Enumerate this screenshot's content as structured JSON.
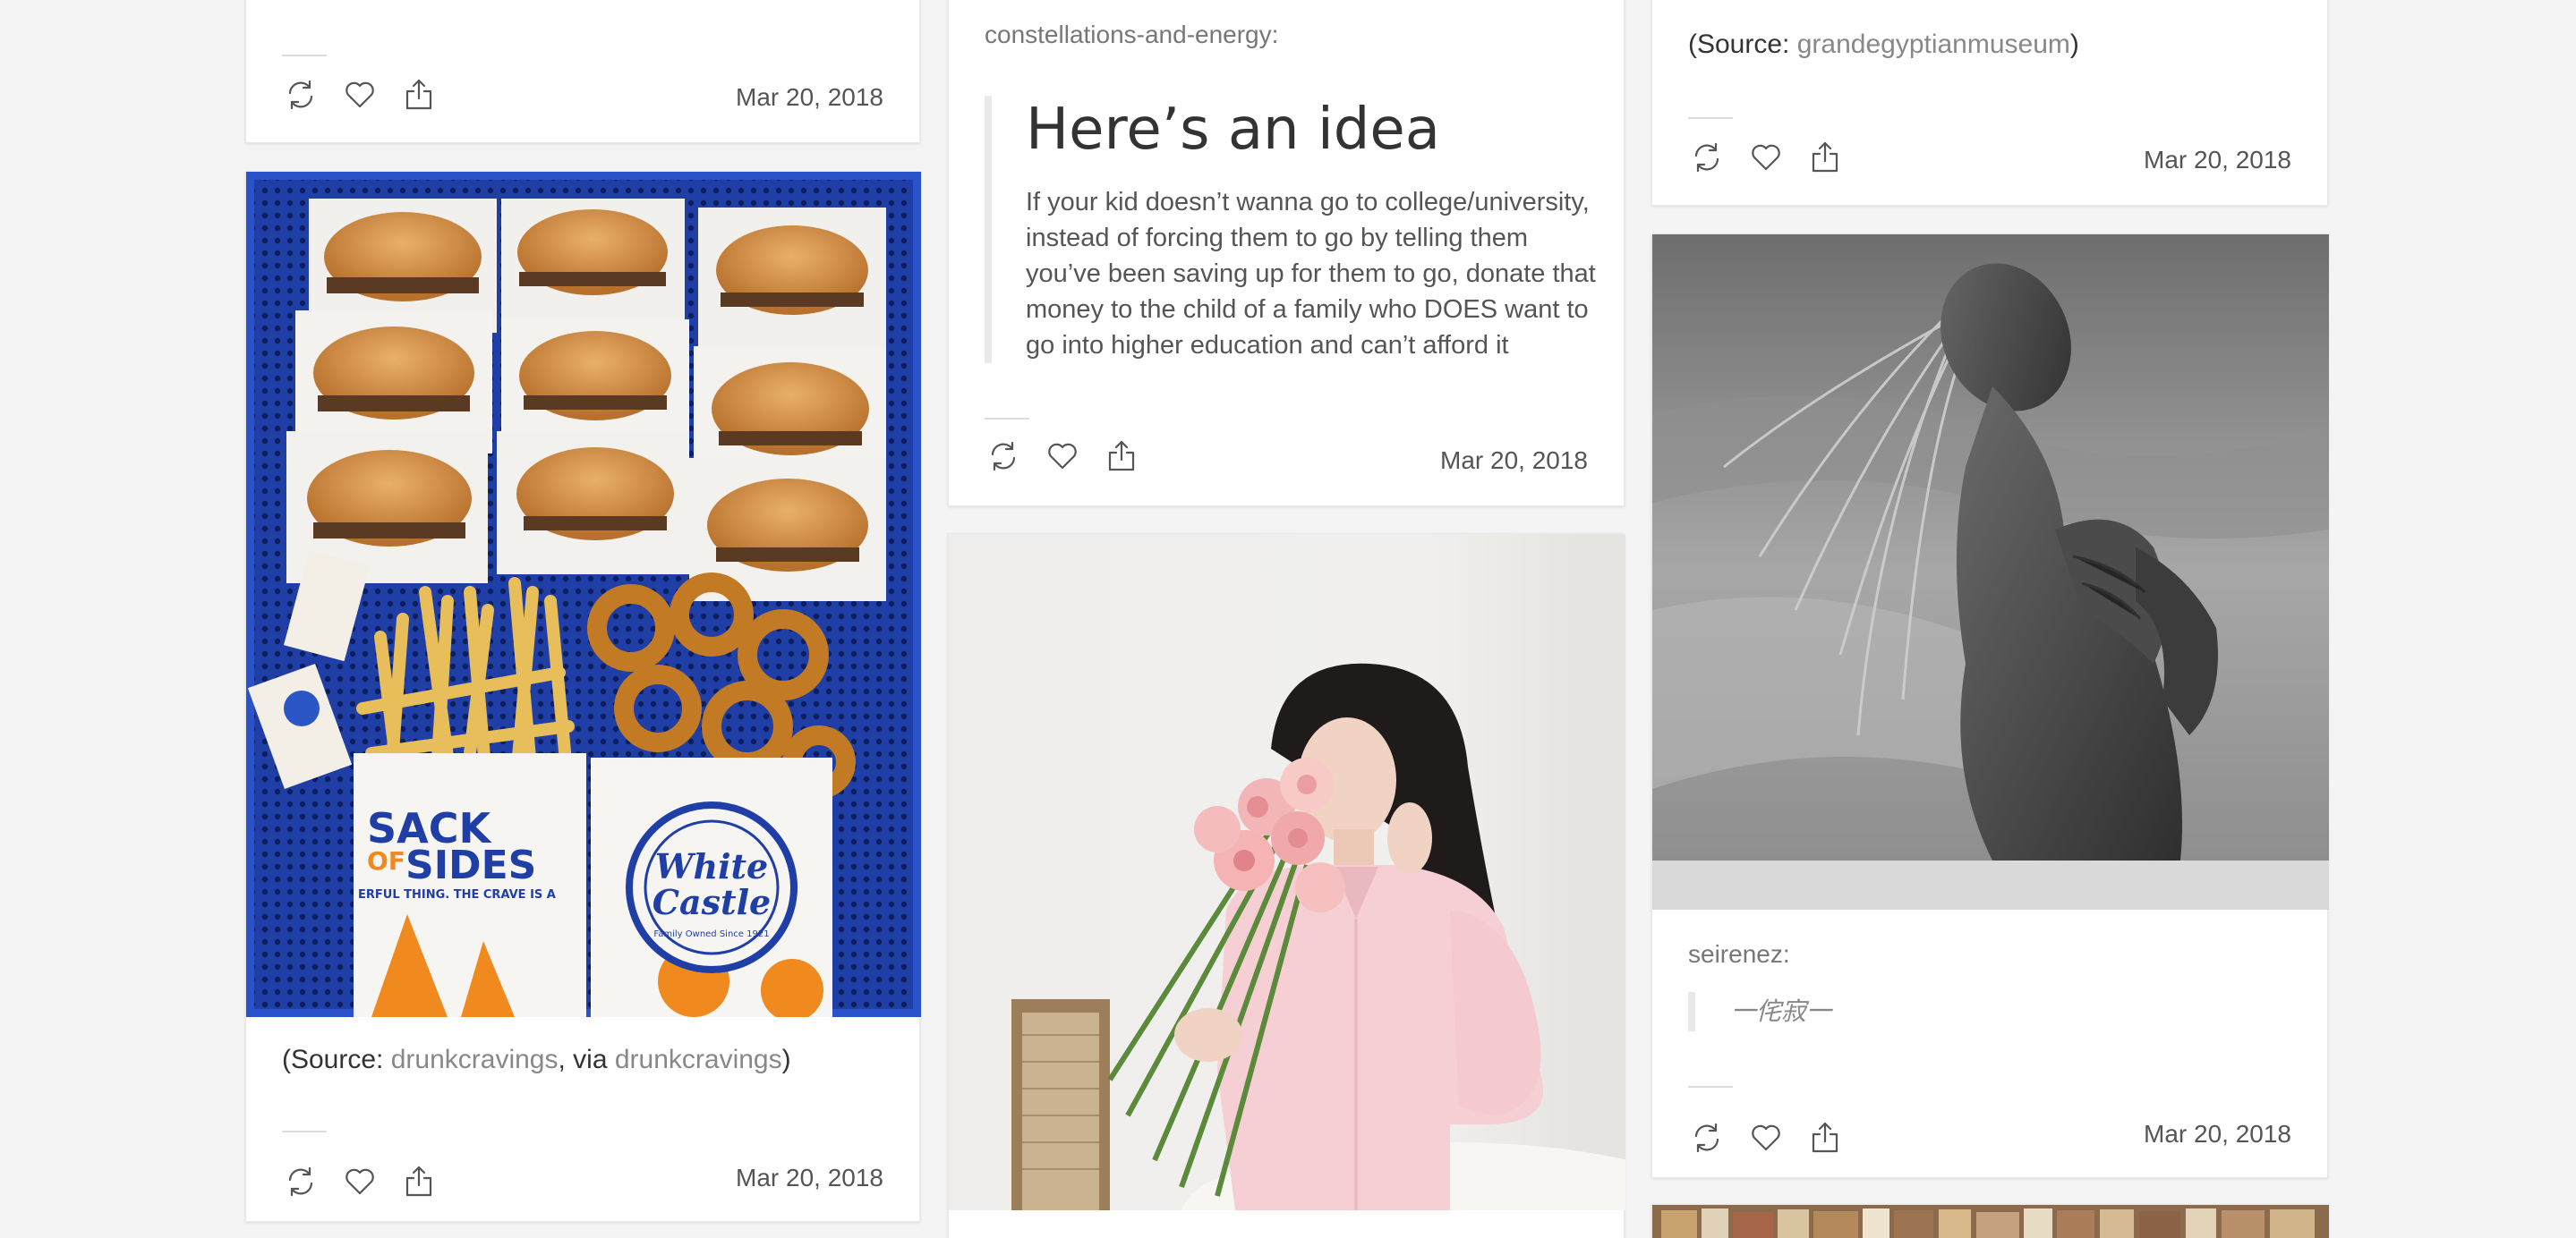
{
  "icons": [
    "reblog-icon",
    "heart-icon",
    "share-icon"
  ],
  "column1": {
    "top_post": {
      "date": "Mar 20, 2018"
    },
    "food_post": {
      "source_prefix": "(Source: ",
      "source_link1": "drunkcravings",
      "source_mid": ", via ",
      "source_link2": "drunkcravings",
      "source_suffix": ")",
      "date": "Mar 20, 2018",
      "bag_text_1": "SACK",
      "bag_text_2": "OF",
      "bag_text_3": "SIDES",
      "bag_slogan": "ERFUL THING. THE CRAVE IS A",
      "logo_text_1": "White",
      "logo_text_2": "Castle",
      "logo_sub": "Family Owned Since 1921"
    }
  },
  "column2": {
    "text_post": {
      "author": "constellations-and-energy:",
      "title": "Here’s an idea",
      "body": "If your kid doesn’t wanna go to college/university, instead of forcing them to go by telling them you’ve been saving up for them to go, donate that money to the child of a family who DOES want to go into higher education and can’t afford it",
      "date": "Mar 20, 2018"
    }
  },
  "column3": {
    "top_post": {
      "source_prefix": "(Source: ",
      "source_link": "grandegyptianmuseum",
      "source_suffix": ")",
      "date": "Mar 20, 2018"
    },
    "bw_post": {
      "author": "seirenez:",
      "quote": "一侘寂一",
      "date": "Mar 20, 2018"
    }
  }
}
